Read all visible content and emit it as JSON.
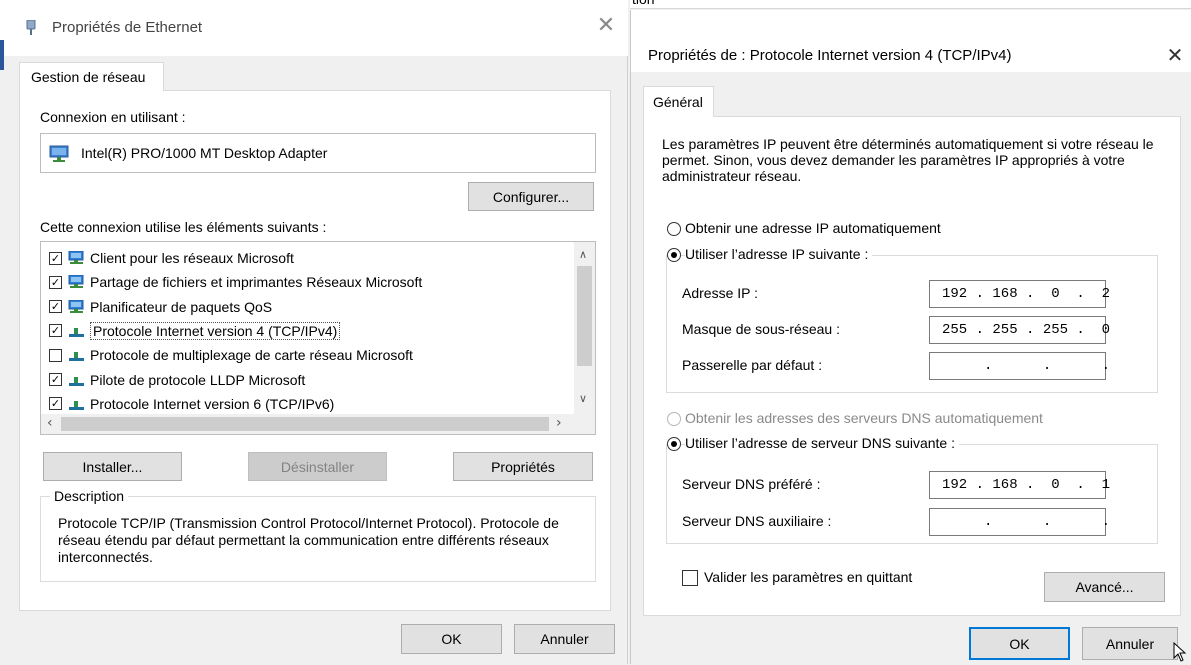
{
  "left_dialog": {
    "title": "Propriétés de Ethernet",
    "tab": "Gestion de réseau",
    "connect_using_label": "Connexion en utilisant :",
    "adapter": "Intel(R) PRO/1000 MT Desktop Adapter",
    "configure_label": "Configurer...",
    "items_label": "Cette connexion utilise les éléments suivants :",
    "items": [
      {
        "label": "Client pour les réseaux Microsoft",
        "checked": true,
        "icon": "network-client-icon"
      },
      {
        "label": "Partage de fichiers et imprimantes Réseaux Microsoft",
        "checked": true,
        "icon": "network-share-icon"
      },
      {
        "label": "Planificateur de paquets QoS",
        "checked": true,
        "icon": "network-qos-icon"
      },
      {
        "label": "Protocole Internet version 4 (TCP/IPv4)",
        "checked": true,
        "icon": "protocol-icon",
        "selected": true
      },
      {
        "label": "Protocole de multiplexage de carte réseau Microsoft",
        "checked": false,
        "icon": "protocol-icon"
      },
      {
        "label": "Pilote de protocole LLDP Microsoft",
        "checked": true,
        "icon": "protocol-icon"
      },
      {
        "label": "Protocole Internet version 6 (TCP/IPv6)",
        "checked": true,
        "icon": "protocol-icon"
      }
    ],
    "install_label": "Installer...",
    "uninstall_label": "Désinstaller",
    "properties_label": "Propriétés",
    "description_title": "Description",
    "description_text": "Protocole TCP/IP (Transmission Control Protocol/Internet Protocol). Protocole de réseau étendu par défaut permettant la communication entre différents réseaux interconnectés.",
    "ok_label": "OK",
    "cancel_label": "Annuler"
  },
  "background_window": {
    "partial_text": "tion"
  },
  "right_dialog": {
    "title": "Propriétés de : Protocole Internet version 4 (TCP/IPv4)",
    "tab": "Général",
    "intro": "Les paramètres IP peuvent être déterminés automatiquement si votre réseau le permet. Sinon, vous devez demander les paramètres IP appropriés à votre administrateur réseau.",
    "ip_auto_label": "Obtenir une adresse IP automatiquement",
    "ip_manual_label": "Utiliser l’adresse IP suivante :",
    "ip_address_label": "Adresse IP :",
    "ip_address_value": "192 . 168 .  0  .  2",
    "subnet_label": "Masque de sous-réseau :",
    "subnet_value": "255 . 255 . 255 .  0",
    "gateway_label": "Passerelle par défaut :",
    "gateway_value": "     .      .      .",
    "dns_auto_label": "Obtenir les adresses des serveurs DNS automatiquement",
    "dns_manual_label": "Utiliser l’adresse de serveur DNS suivante :",
    "dns_pref_label": "Serveur DNS préféré :",
    "dns_pref_value": "192 . 168 .  0  .  1",
    "dns_alt_label": "Serveur DNS auxiliaire :",
    "dns_alt_value": "     .      .      .",
    "validate_label": "Valider les paramètres en quittant",
    "advanced_label": "Avancé...",
    "ok_label": "OK",
    "cancel_label": "Annuler"
  }
}
